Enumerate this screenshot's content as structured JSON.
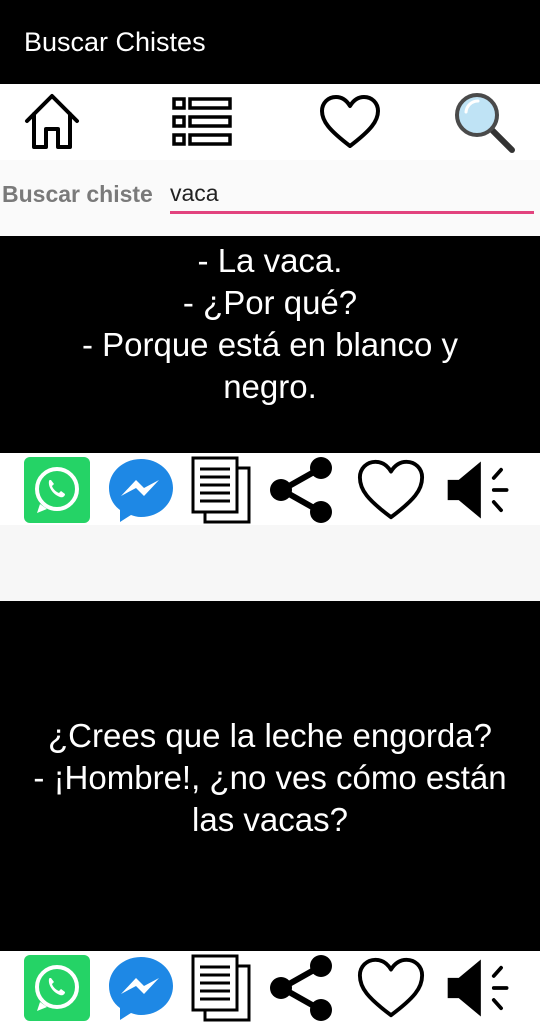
{
  "app": {
    "title": "Buscar Chistes"
  },
  "nav": {
    "items": [
      "home-icon",
      "list-icon",
      "heart-icon",
      "search-icon"
    ]
  },
  "search": {
    "label": "Buscar chiste",
    "value": "vaca"
  },
  "jokes": [
    {
      "lines": [
        "- La vaca.",
        "- ¿Por qué?",
        "- Porque está en blanco y",
        "negro."
      ]
    },
    {
      "lines": [
        "¿Crees que la leche engorda?",
        "- ¡Hombre!, ¿no ves cómo están",
        "las vacas?"
      ]
    }
  ],
  "actions": [
    "whatsapp-icon",
    "messenger-icon",
    "copy-icon",
    "share-icon",
    "favorite-icon",
    "speaker-icon"
  ],
  "colors": {
    "appbar": "#000000",
    "accent": "#e2437e",
    "whatsapp": "#25d366",
    "messenger": "#1e88e5"
  }
}
